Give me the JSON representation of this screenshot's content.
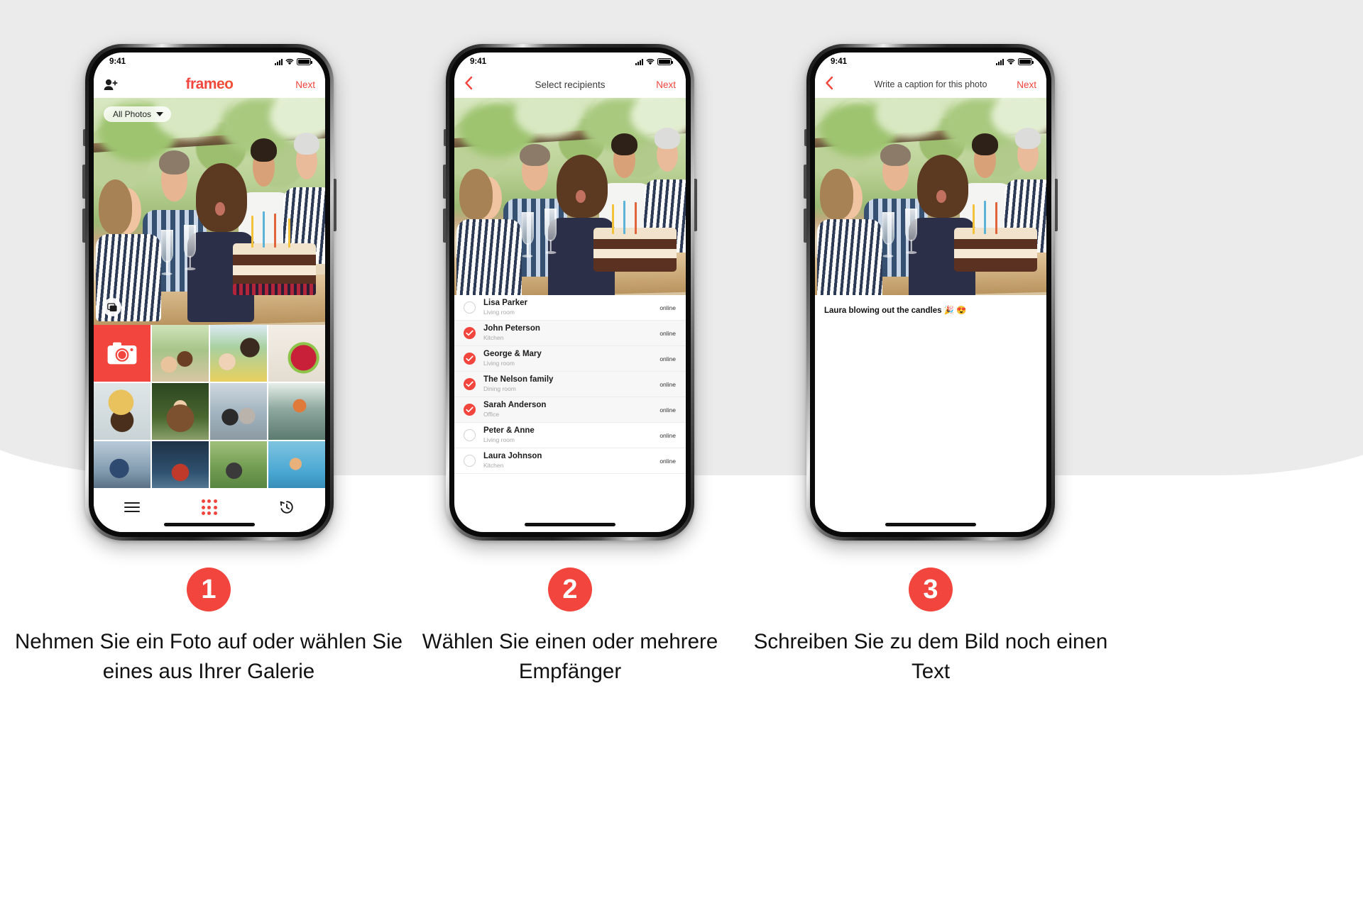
{
  "status_bar": {
    "time": "9:41",
    "icons": [
      "signal-bars",
      "wifi",
      "battery"
    ]
  },
  "brand": {
    "name": "frameo",
    "accent": "#F2453D",
    "accent2": "#F36A22"
  },
  "phones": [
    {
      "id": "gallery",
      "nav": {
        "add_user_icon": "add-user-icon",
        "title": "frameo",
        "next_label": "Next"
      },
      "album_chip": {
        "label": "All Photos",
        "caret_icon": "chevron-down-icon"
      },
      "multi_select_icon": "multi-photo-icon",
      "camera_tile_icon": "camera-icon",
      "tabbar": {
        "menu_icon": "hamburger-menu-icon",
        "grid_icon": "grid-icon",
        "history_icon": "history-clock-icon"
      }
    },
    {
      "id": "recipients",
      "nav": {
        "back_icon": "chevron-left-icon",
        "title": "Select recipients",
        "next_label": "Next"
      },
      "recipients": [
        {
          "name": "Lisa Parker",
          "room": "Living room",
          "status": "online",
          "selected": false
        },
        {
          "name": "John Peterson",
          "room": "Kitchen",
          "status": "online",
          "selected": true
        },
        {
          "name": "George & Mary",
          "room": "Living room",
          "status": "online",
          "selected": true
        },
        {
          "name": "The Nelson family",
          "room": "Dining room",
          "status": "online",
          "selected": true
        },
        {
          "name": "Sarah Anderson",
          "room": "Office",
          "status": "online",
          "selected": true
        },
        {
          "name": "Peter & Anne",
          "room": "Living room",
          "status": "online",
          "selected": false
        },
        {
          "name": "Laura Johnson",
          "room": "Kitchen",
          "status": "online",
          "selected": false
        }
      ]
    },
    {
      "id": "caption",
      "nav": {
        "back_icon": "chevron-left-icon",
        "title": "Write a caption for this photo",
        "next_label": "Next"
      },
      "caption_value": "Laura blowing out the candles 🎉 😍",
      "caption_placeholder": "Write a caption for this photo"
    }
  ],
  "steps": [
    {
      "number": "1",
      "text": "Nehmen Sie ein Foto auf oder wählen Sie eines aus Ihrer Galerie"
    },
    {
      "number": "2",
      "text": "Wählen Sie einen oder mehrere Empfänger"
    },
    {
      "number": "3",
      "text": "Schreiben Sie zu dem Bild noch einen Text"
    }
  ]
}
